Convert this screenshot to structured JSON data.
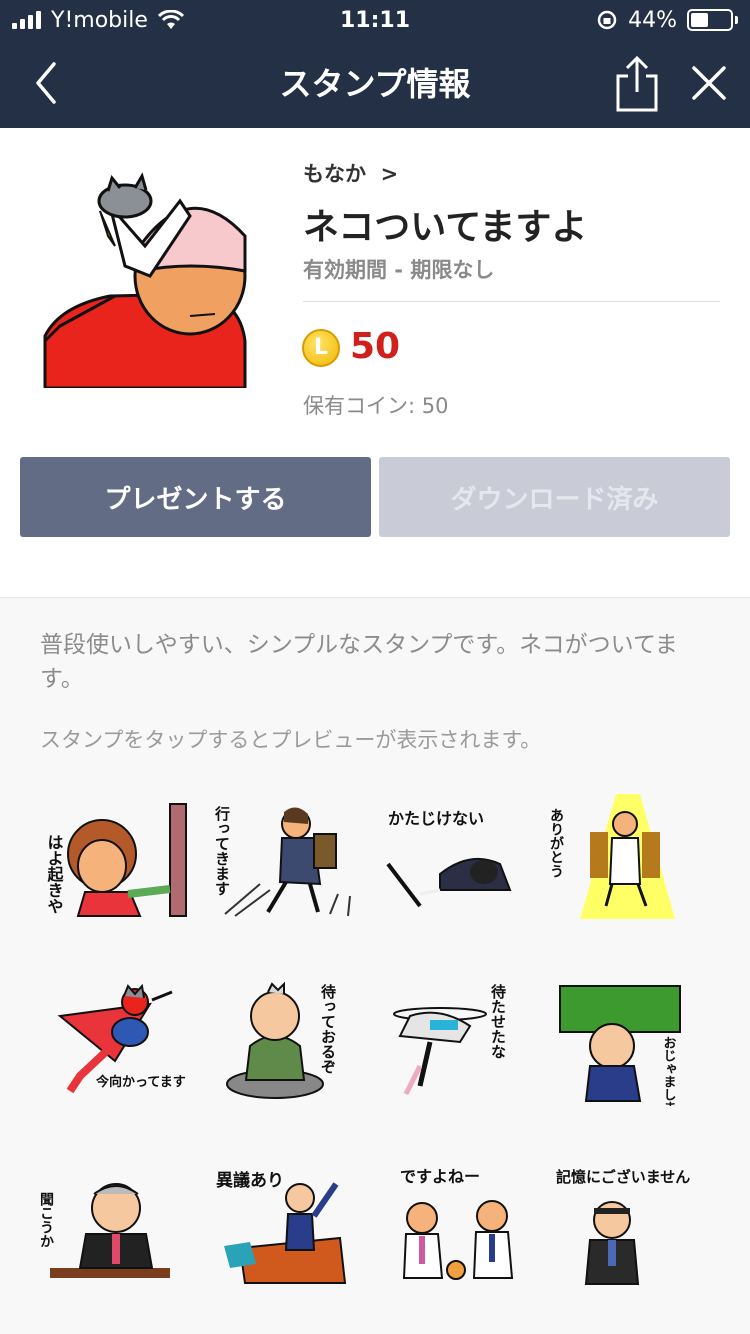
{
  "status_bar": {
    "carrier": "Y!mobile",
    "time": "11:11",
    "battery_percent": "44%"
  },
  "nav": {
    "title": "スタンプ情報",
    "back_icon": "chevron-left-icon",
    "share_icon": "share-icon",
    "close_icon": "close-icon"
  },
  "product": {
    "author": "もなか",
    "title": "ネコついてますよ",
    "validity": "有効期間 - 期限なし",
    "coin_letter": "L",
    "price": "50",
    "owned": "保有コイン: 50"
  },
  "buttons": {
    "present": "プレゼントする",
    "downloaded": "ダウンロード済み"
  },
  "description": "普段使いしやすい、シンプルなスタンプです。ネコがついてます。",
  "hint": "スタンプをタップするとプレビューが表示されます。",
  "stickers": [
    {
      "caption": "はよ起きや"
    },
    {
      "caption": "行ってきます"
    },
    {
      "caption": "かたじけない"
    },
    {
      "caption": "ありがとう"
    },
    {
      "caption": "今向かってます"
    },
    {
      "caption": "待っておるぞ"
    },
    {
      "caption": "待たせたな"
    },
    {
      "caption": "おじゃましますよ"
    },
    {
      "caption": "聞こうか"
    },
    {
      "caption": "異議あり"
    },
    {
      "caption": "ですよねー"
    },
    {
      "caption": "記憶にございません"
    }
  ],
  "colors": {
    "nav_bg": "#243046",
    "price_red": "#d0201c",
    "present_button": "#626d85",
    "downloaded_button": "#c9ccd6"
  }
}
